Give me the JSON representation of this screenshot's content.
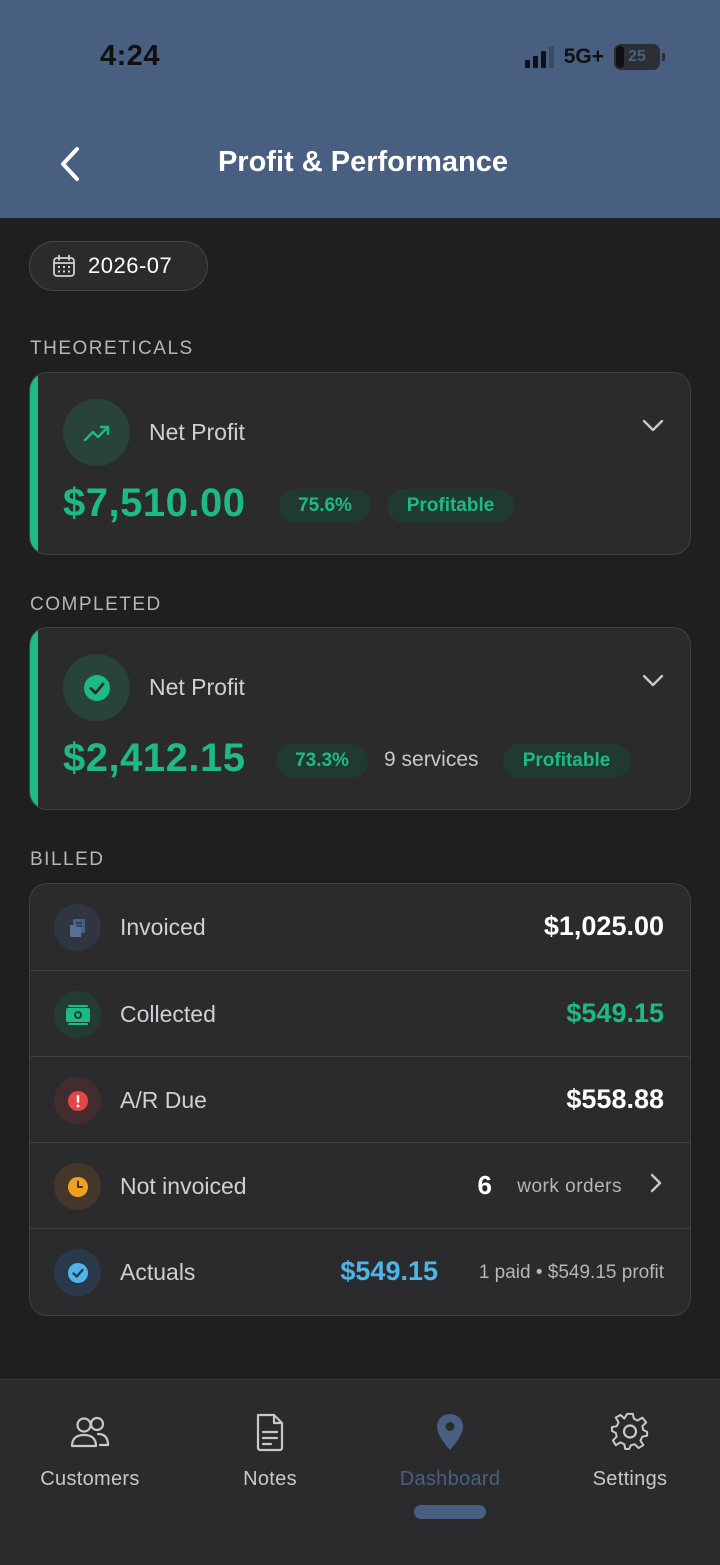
{
  "status_bar": {
    "time": "4:24",
    "network": "5G+",
    "battery": "25"
  },
  "header": {
    "title": "Profit & Performance"
  },
  "date_filter": {
    "label": "2026-07"
  },
  "theoreticals": {
    "section_label": "THEORETICALS",
    "title": "Net Profit",
    "amount": "$7,510.00",
    "margin": "75.6%",
    "status": "Profitable"
  },
  "completed": {
    "section_label": "COMPLETED",
    "title": "Net Profit",
    "amount": "$2,412.15",
    "margin": "73.3%",
    "services": "9 services",
    "status": "Profitable"
  },
  "billed": {
    "section_label": "BILLED",
    "invoiced": {
      "label": "Invoiced",
      "value": "$1,025.00"
    },
    "collected": {
      "label": "Collected",
      "value": "$549.15"
    },
    "ar_due": {
      "label": "A/R Due",
      "value": "$558.88"
    },
    "not_invoiced": {
      "label": "Not invoiced",
      "count": "6",
      "unit": "work orders"
    },
    "actuals": {
      "label": "Actuals",
      "value": "$549.15",
      "sub": "1 paid • $549.15 profit"
    }
  },
  "tabs": [
    {
      "label": "Customers",
      "icon": "users-icon"
    },
    {
      "label": "Notes",
      "icon": "document-icon"
    },
    {
      "label": "Dashboard",
      "icon": "location-pin-icon",
      "active": true
    },
    {
      "label": "Settings",
      "icon": "gear-icon"
    }
  ],
  "colors": {
    "header": "#485f82",
    "background": "#1f1f21",
    "card": "#2b2b2e",
    "profit_green": "#1dbb83",
    "actuals_blue": "#4fb4ea",
    "alert_red": "#e04848",
    "pending_orange": "#f0a020"
  }
}
